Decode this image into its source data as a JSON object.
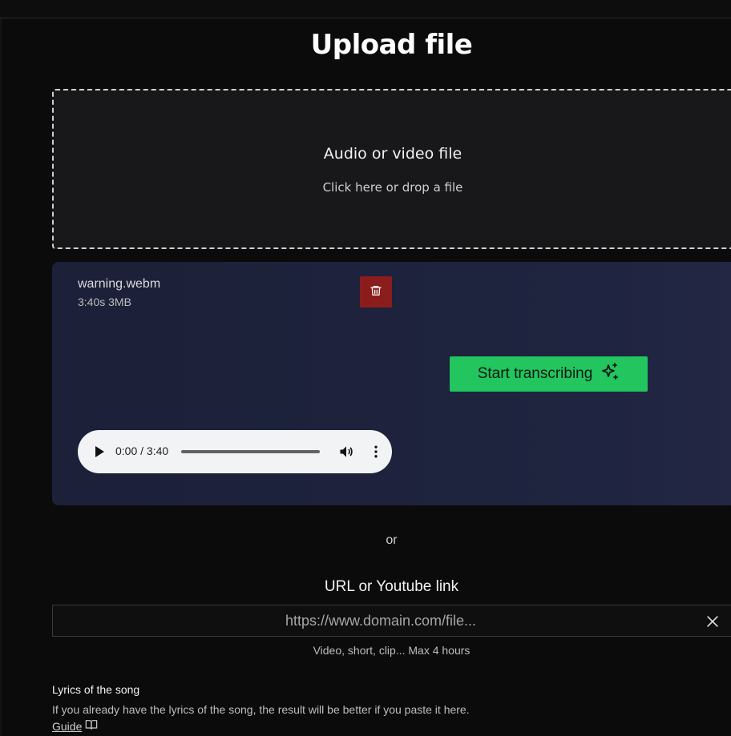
{
  "page": {
    "title": "Upload file"
  },
  "dropzone": {
    "title": "Audio or video file",
    "subtitle": "Click here or drop a file"
  },
  "file": {
    "name": "warning.webm",
    "meta": "3:40s 3MB",
    "delete_icon": "trash-icon",
    "start_label": "Start transcribing",
    "start_icon": "sparkles-icon"
  },
  "player": {
    "time": "0:00 / 3:40",
    "progress": 0,
    "play_icon": "play-icon",
    "volume_icon": "volume-icon",
    "more_icon": "more-vertical-icon"
  },
  "divider": {
    "or": "or"
  },
  "url": {
    "title": "URL or Youtube link",
    "placeholder": "https://www.domain.com/file...",
    "value": "",
    "clear_icon": "close-icon",
    "hint": "Video, short, clip... Max 4 hours"
  },
  "lyrics": {
    "label": "Lyrics of the song",
    "description": "If you already have the lyrics of the song, the result will be better if you paste it here.",
    "guide_link": "Guide",
    "guide_icon": "book-open-icon"
  },
  "colors": {
    "background": "#0b0b0b",
    "card": "#1f2440",
    "accent_green": "#22c55e",
    "danger_red": "#8b1c1c"
  }
}
